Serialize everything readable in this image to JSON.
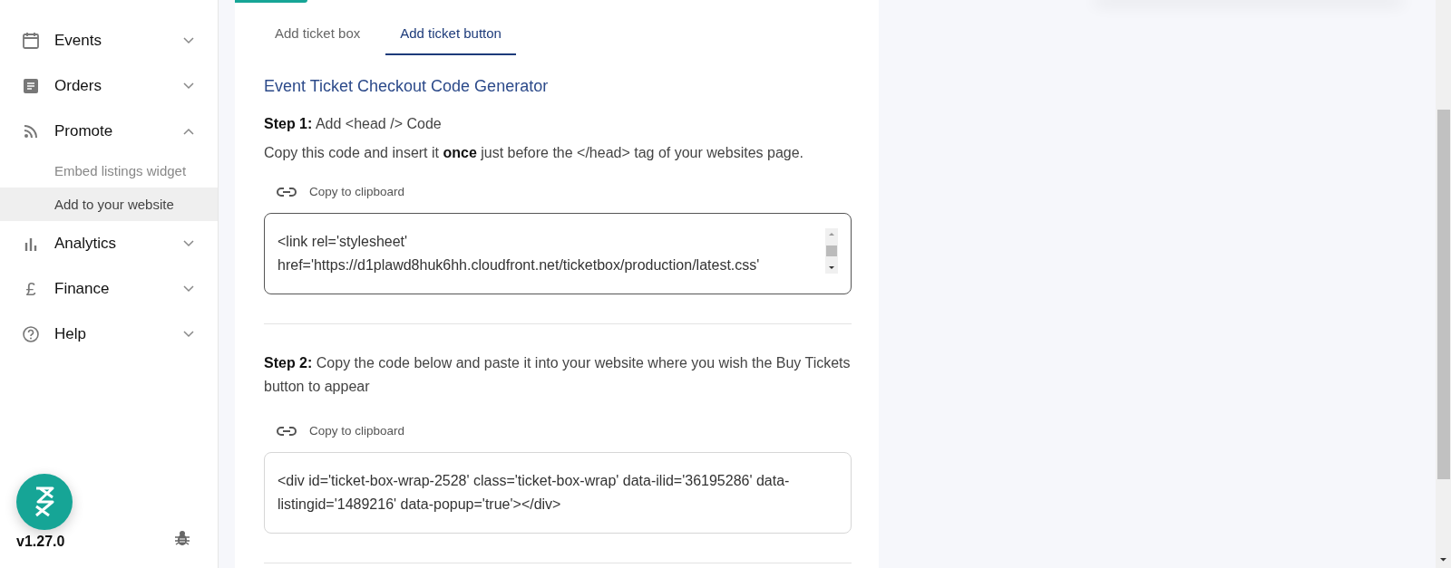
{
  "sidebar": {
    "items": [
      {
        "label": "Events",
        "expanded": false
      },
      {
        "label": "Orders",
        "expanded": false
      },
      {
        "label": "Promote",
        "expanded": true,
        "children": [
          {
            "label": "Embed listings widget",
            "selected": false
          },
          {
            "label": "Add to your website",
            "selected": true
          }
        ]
      },
      {
        "label": "Analytics",
        "expanded": false
      },
      {
        "label": "Finance",
        "glyph": "£",
        "expanded": false
      },
      {
        "label": "Help",
        "expanded": false
      }
    ],
    "version": "v1.27.0"
  },
  "tabs": [
    {
      "label": "Add ticket box",
      "selected": false
    },
    {
      "label": "Add ticket button",
      "selected": true
    }
  ],
  "title": "Event Ticket Checkout Code Generator",
  "steps": [
    {
      "heading": "**Step 1:** Add <head /> Code",
      "description": "Copy this code and insert it **once** just before the </head> tag of your websites page.",
      "copy_label": "Copy to clipboard",
      "code": "<link rel='stylesheet' href='https://d1plawd8huk6hh.cloudfront.net/ticketbox/production/latest.css'",
      "scrollable": true
    },
    {
      "heading": "**Step 2:** Copy the code below and paste it into your website where you wish the Buy Tickets button to appear",
      "copy_label": "Copy to clipboard",
      "code": "<div id='ticket-box-wrap-2528' class='ticket-box-wrap' data-ilid='36195286' data-listingid='1489216' data-popup='true'></div>",
      "scrollable": false
    }
  ]
}
